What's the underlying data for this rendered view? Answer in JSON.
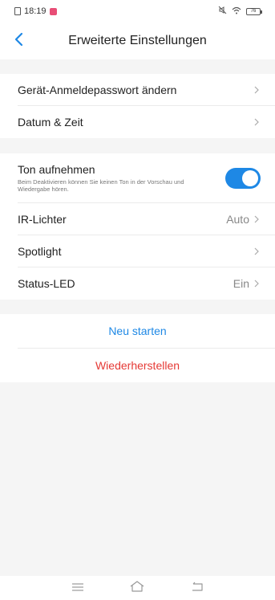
{
  "status_bar": {
    "time": "18:19",
    "battery": "76"
  },
  "header": {
    "title": "Erweiterte Einstellungen"
  },
  "section1": {
    "items": [
      {
        "label": "Gerät-Anmeldepasswort ändern"
      },
      {
        "label": "Datum & Zeit"
      }
    ]
  },
  "section2": {
    "ton": {
      "title": "Ton aufnehmen",
      "subtitle": "Beim Deaktivieren können Sie keinen Ton in der Vorschau und Wiedergabe hören.",
      "enabled": true
    },
    "items": [
      {
        "label": "IR-Lichter",
        "value": "Auto"
      },
      {
        "label": "Spotlight",
        "value": ""
      },
      {
        "label": "Status-LED",
        "value": "Ein"
      }
    ]
  },
  "actions": {
    "restart": "Neu starten",
    "restore": "Wiederherstellen"
  },
  "colors": {
    "accent": "#1e88e5",
    "danger": "#e53935",
    "background": "#f5f5f5"
  }
}
